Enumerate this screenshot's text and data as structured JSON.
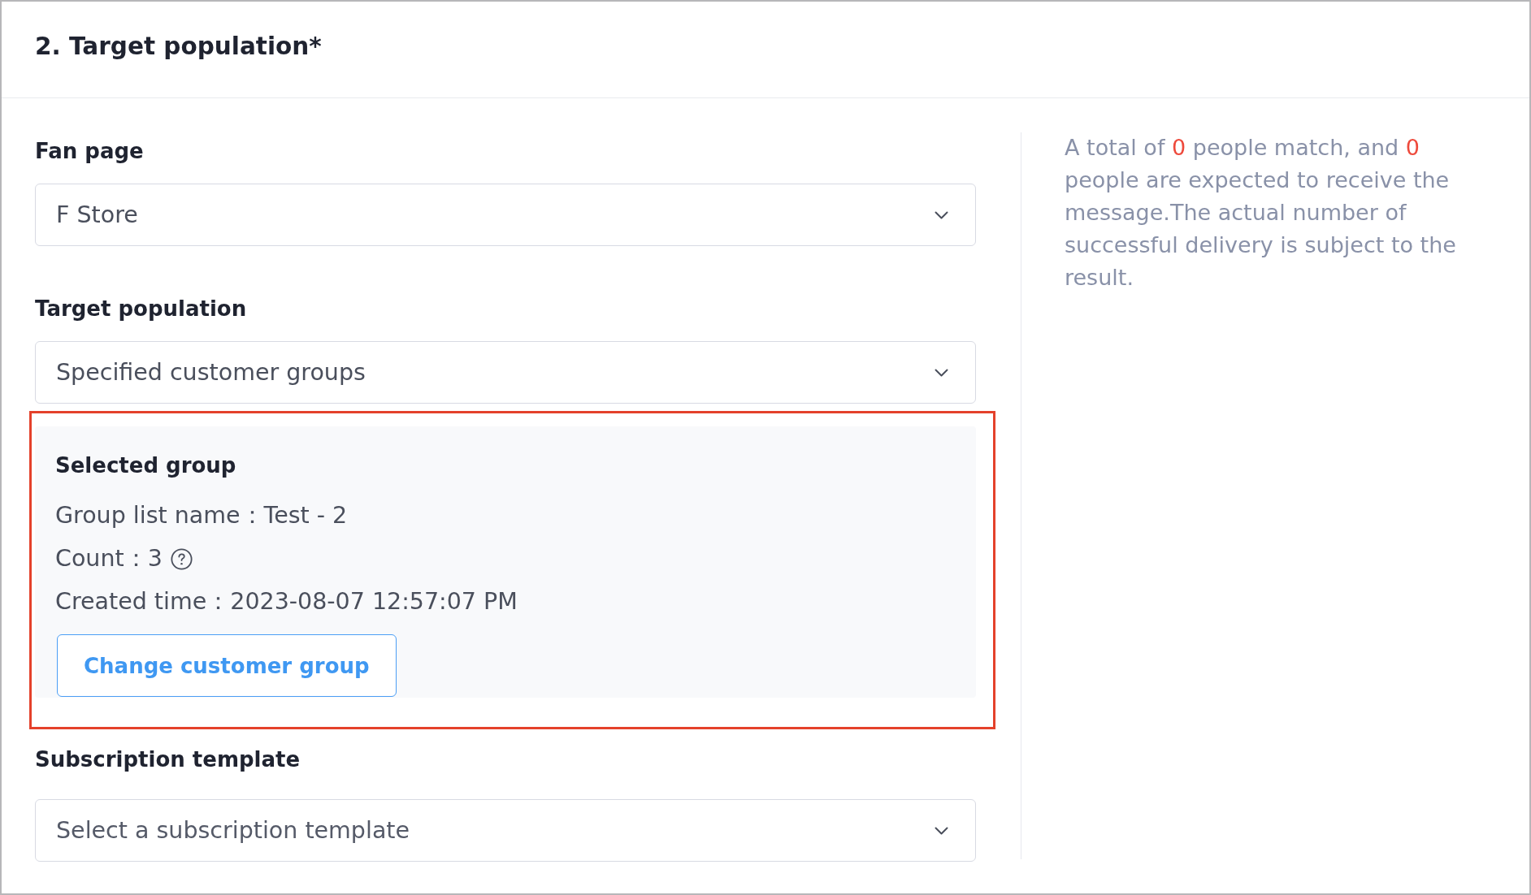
{
  "section": {
    "title": "2. Target population*"
  },
  "fields": [
    {
      "kind": "select",
      "label": "Fan page",
      "value": "F Store"
    },
    {
      "kind": "select",
      "label": "Target population",
      "value": "Specified customer groups"
    },
    {
      "kind": "group",
      "highlighted": true,
      "title": "Selected group",
      "details": [
        {
          "label": "Group list name：",
          "value": "Test - 2",
          "help": false
        },
        {
          "label": "Count：",
          "value": "3",
          "help": true
        },
        {
          "label": "Created time：",
          "value": "2023-08-07 12:57:07 PM",
          "help": false
        }
      ],
      "button": "Change customer group"
    },
    {
      "kind": "select",
      "label": "Subscription template",
      "placeholder": "Select a subscription template"
    }
  ],
  "summary": {
    "segments": [
      {
        "kind": "plain",
        "text": "A total of "
      },
      {
        "kind": "count",
        "text": "0"
      },
      {
        "kind": "plain",
        "text": " people match, and "
      },
      {
        "kind": "count",
        "text": "0"
      },
      {
        "kind": "plain",
        "text": " people are expected to receive the message.The actual number of successful delivery is subject to the result."
      }
    ]
  }
}
